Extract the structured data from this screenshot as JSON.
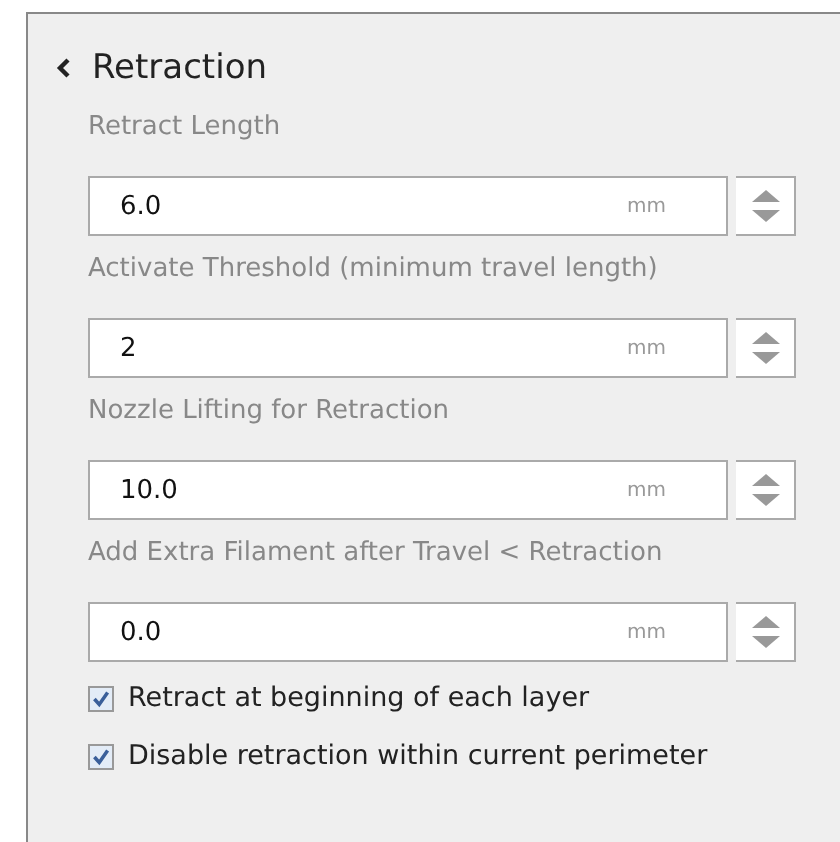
{
  "panel": {
    "title": "Retraction",
    "expanded": true
  },
  "fields": [
    {
      "label": "Retract Length",
      "value": "6.0",
      "unit": "mm"
    },
    {
      "label": "Activate Threshold (minimum travel length)",
      "value": "2",
      "unit": "mm"
    },
    {
      "label": "Nozzle Lifting for Retraction",
      "value": "10.0",
      "unit": "mm"
    },
    {
      "label": "Add Extra Filament after Travel < Retraction",
      "value": "0.0",
      "unit": "mm"
    }
  ],
  "checkboxes": [
    {
      "label": "Retract at beginning of each layer",
      "checked": true
    },
    {
      "label": "Disable retraction within current perimeter",
      "checked": true
    }
  ]
}
